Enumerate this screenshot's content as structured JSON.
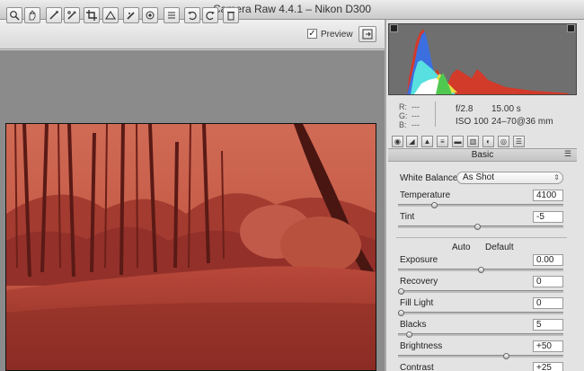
{
  "window": {
    "title": "Camera Raw 4.4.1  –  Nikon D300"
  },
  "toolbar": {
    "tools": [
      "zoom-icon",
      "hand-icon",
      "white-balance-icon",
      "color-sampler-icon",
      "crop-icon",
      "straighten-icon",
      "retouch-icon",
      "red-eye-icon",
      "presets-icon",
      "rotate-left-icon",
      "rotate-right-icon",
      "trash-icon"
    ],
    "preview_label": "Preview",
    "preview_checked": "✓"
  },
  "info": {
    "r_label": "R:",
    "g_label": "G:",
    "b_label": "B:",
    "r_value": "---",
    "g_value": "---",
    "b_value": "---",
    "aperture": "f/2.8",
    "shutter": "15.00 s",
    "iso": "ISO 100",
    "lens": "24–70@36 mm"
  },
  "panel": {
    "section_title": "Basic",
    "white_balance_label": "White Balance:",
    "white_balance_value": "As Shot",
    "auto_label": "Auto",
    "default_label": "Default",
    "sliders": [
      {
        "label": "Temperature",
        "value": "4100",
        "pos": 0.21
      },
      {
        "label": "Tint",
        "value": "-5",
        "pos": 0.48
      },
      {
        "label": "Exposure",
        "value": "0.00",
        "pos": 0.5
      },
      {
        "label": "Recovery",
        "value": "0",
        "pos": 0.0
      },
      {
        "label": "Fill Light",
        "value": "0",
        "pos": 0.0
      },
      {
        "label": "Blacks",
        "value": "5",
        "pos": 0.05
      },
      {
        "label": "Brightness",
        "value": "+50",
        "pos": 0.66
      },
      {
        "label": "Contrast",
        "value": "+25",
        "pos": 0.62
      }
    ]
  },
  "colors": {
    "photo_tint": "#c8513f",
    "panel_bg": "#e3e3e3"
  }
}
